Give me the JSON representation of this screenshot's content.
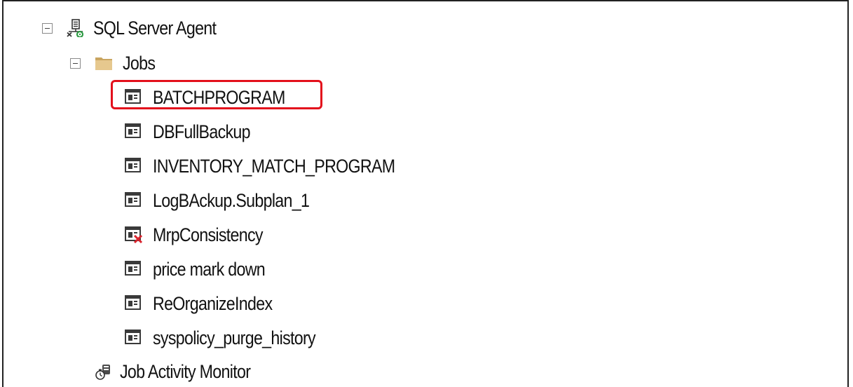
{
  "tree": {
    "agent": {
      "label": "SQL Server Agent",
      "icon": "sql-agent-icon"
    },
    "jobs_folder": {
      "label": "Jobs",
      "icon": "folder-icon"
    },
    "jobs": [
      {
        "label": "BATCHPROGRAM",
        "icon": "job-icon",
        "status": "enabled",
        "highlighted": true
      },
      {
        "label": "DBFullBackup",
        "icon": "job-icon",
        "status": "enabled"
      },
      {
        "label": "INVENTORY_MATCH_PROGRAM",
        "icon": "job-icon",
        "status": "enabled"
      },
      {
        "label": "LogBAckup.Subplan_1",
        "icon": "job-icon",
        "status": "enabled"
      },
      {
        "label": "MrpConsistency",
        "icon": "job-disabled-icon",
        "status": "disabled"
      },
      {
        "label": "price mark down",
        "icon": "job-icon",
        "status": "enabled"
      },
      {
        "label": "ReOrganizeIndex",
        "icon": "job-icon",
        "status": "enabled"
      },
      {
        "label": "syspolicy_purge_history",
        "icon": "job-icon",
        "status": "enabled"
      }
    ],
    "activity_monitor": {
      "label": "Job Activity Monitor",
      "icon": "job-activity-monitor-icon"
    }
  },
  "colors": {
    "highlight_border": "#e3101c",
    "disabled_x": "#d9232d",
    "folder": "#dcb97c",
    "agent_green": "#2d9b43"
  }
}
